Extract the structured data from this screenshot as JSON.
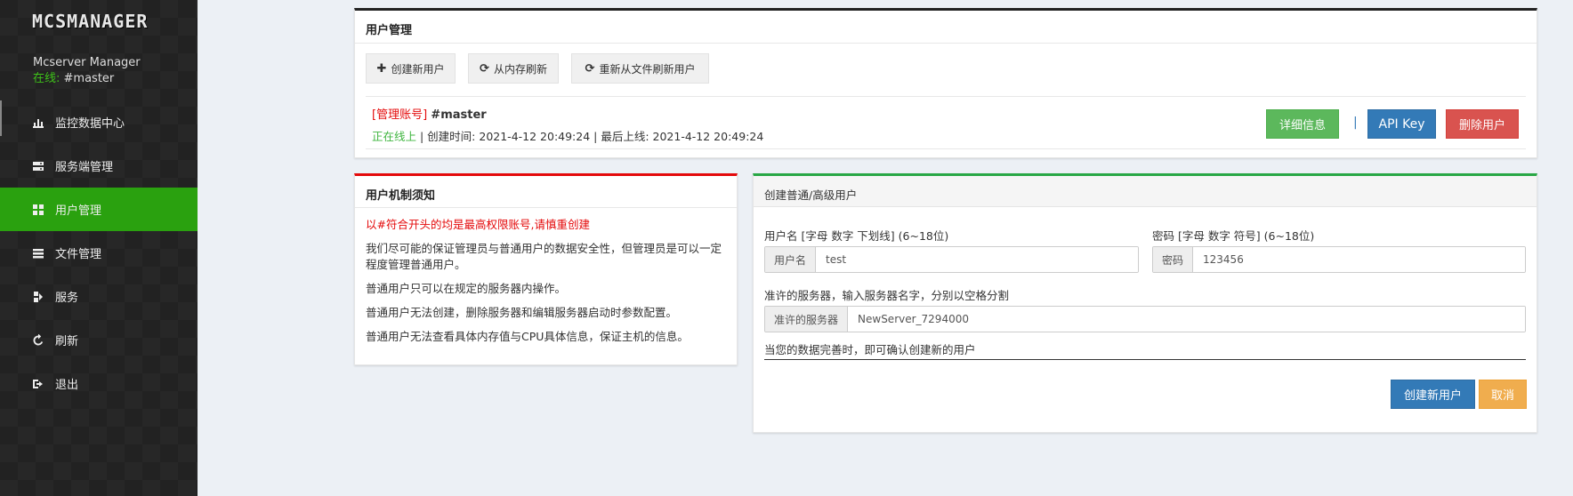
{
  "brand": {
    "logo": "MCSMANAGER",
    "subtitle": "Mcserver Manager",
    "status_label": "在线:",
    "user": "#master"
  },
  "nav": [
    {
      "label": "监控数据中心",
      "icon": "dashboard-icon"
    },
    {
      "label": "服务端管理",
      "icon": "server-icon"
    },
    {
      "label": "用户管理",
      "icon": "grid-icon"
    },
    {
      "label": "文件管理",
      "icon": "list-icon"
    },
    {
      "label": "服务",
      "icon": "service-icon"
    },
    {
      "label": "刷新",
      "icon": "refresh-icon"
    },
    {
      "label": "退出",
      "icon": "logout-icon"
    }
  ],
  "user_mgmt": {
    "title": "用户管理",
    "buttons": {
      "create": "创建新用户",
      "refresh_memory": "从内存刷新",
      "refresh_file": "重新从文件刷新用户"
    },
    "admin_tag": "[管理账号]",
    "username": "#master",
    "online_status": "正在线上",
    "times": "| 创建时间: 2021-4-12 20:49:24 | 最后上线: 2021-4-12 20:49:24",
    "detail_btn": "详细信息",
    "separator": "|",
    "api_key_btn": "API Key",
    "delete_btn": "删除用户"
  },
  "notice": {
    "title": "用户机制须知",
    "warning": "以#符合开头的均是最高权限账号,请慎重创建",
    "p1": "我们尽可能的保证管理员与普通用户的数据安全性，但管理员是可以一定程度管理普通用户。",
    "p2": "普通用户只可以在规定的服务器内操作。",
    "p3": "普通用户无法创建，删除服务器和编辑服务器启动时参数配置。",
    "p4": "普通用户无法查看具体内存值与CPU具体信息，保证主机的信息。"
  },
  "create_form": {
    "title": "创建普通/高级用户",
    "username_label": "用户名 [字母 数字 下划线] (6~18位)",
    "username_addon": "用户名",
    "username_value": "test",
    "password_label": "密码 [字母 数字 符号] (6~18位)",
    "password_addon": "密码",
    "password_value": "123456",
    "servers_label": "准许的服务器，输入服务器名字，分别以空格分割",
    "servers_addon": "准许的服务器",
    "servers_value": "NewServer_7294000",
    "hint": "当您的数据完善时，即可确认创建新的用户",
    "submit_btn": "创建新用户",
    "cancel_btn": "取消"
  },
  "colors": {
    "sidebar_bg": "#222222",
    "active": "#2aa10f",
    "online": "#3fc31a",
    "warning": "#e4090a",
    "form_accent": "#28a745",
    "notice_accent": "#e4090a"
  }
}
